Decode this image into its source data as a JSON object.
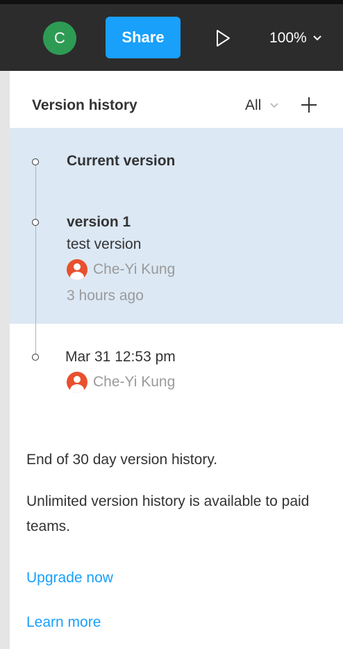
{
  "toolbar": {
    "avatar_initial": "C",
    "share_label": "Share",
    "zoom_label": "100%"
  },
  "panel": {
    "title": "Version history",
    "filter_label": "All"
  },
  "versions": [
    {
      "title": "Current version"
    },
    {
      "title": "version 1",
      "description": "test version",
      "author": "Che-Yi Kung",
      "time": "3 hours ago"
    },
    {
      "title": "Mar 31 12:53 pm",
      "author": "Che-Yi Kung"
    }
  ],
  "footer": {
    "end_text": "End of 30 day version history.",
    "unlimited_text": "Unlimited version history is available to paid teams.",
    "upgrade_link": "Upgrade now",
    "learn_link": "Learn more"
  },
  "colors": {
    "accent": "#18a0fb",
    "selected_bg": "#dce8f4",
    "avatar_green": "#2e9b55",
    "user_avatar": "#e8502e"
  }
}
